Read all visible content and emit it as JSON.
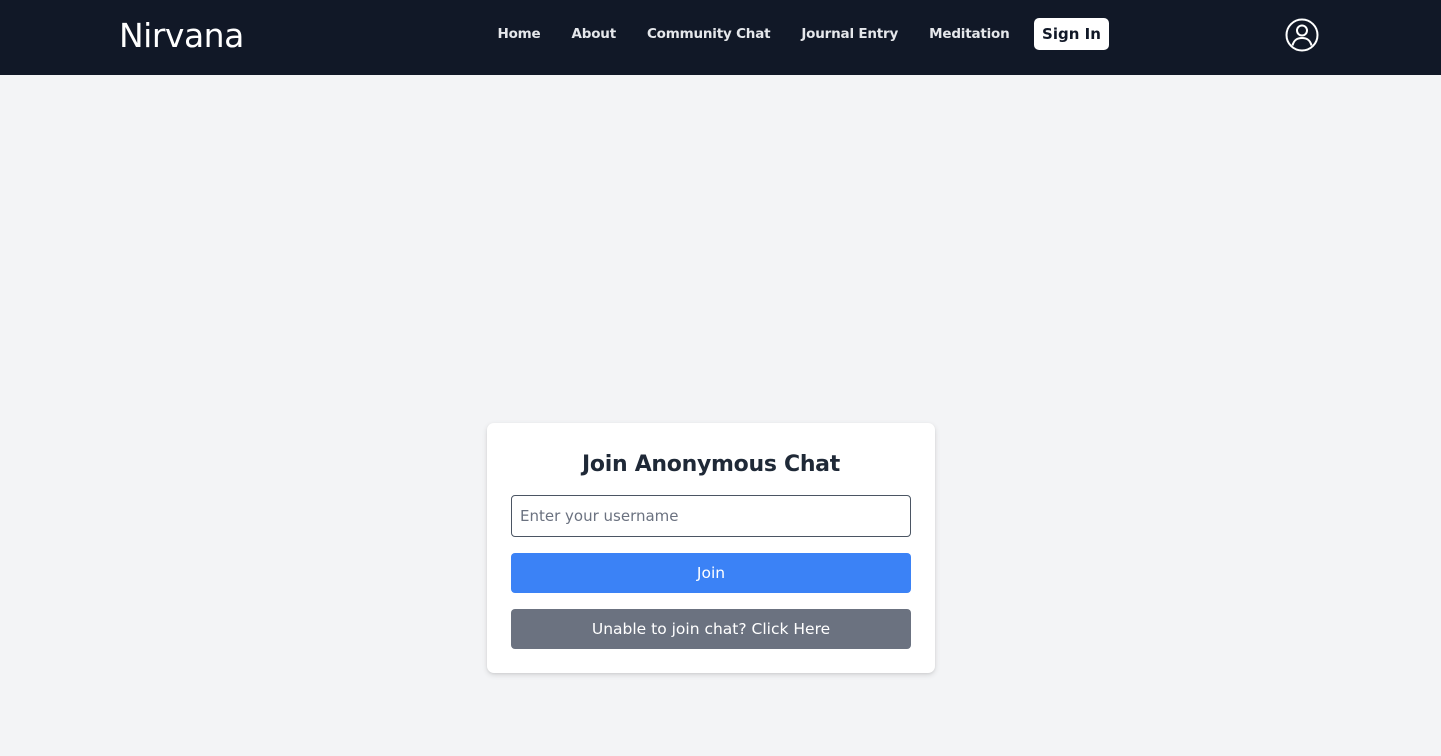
{
  "brand": {
    "name": "Nirvana"
  },
  "nav": {
    "links": [
      "Home",
      "About",
      "Community Chat",
      "Journal Entry",
      "Meditation"
    ],
    "sign_in_label": "Sign In",
    "user_icon": "user-circle-icon"
  },
  "join_card": {
    "title": "Join Anonymous Chat",
    "username_placeholder": "Enter your username",
    "username_value": "",
    "join_label": "Join",
    "help_label": "Unable to join chat? Click Here"
  },
  "colors": {
    "navbar_bg": "#111827",
    "page_bg": "#f3f4f6",
    "join_button": "#3b82f6",
    "help_button": "#6b7280"
  }
}
